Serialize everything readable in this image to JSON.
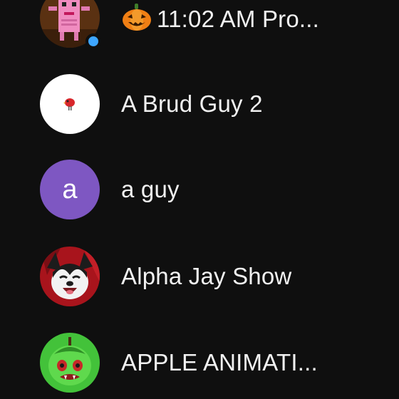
{
  "subscriptions": [
    {
      "name": "11:02 AM Pro...",
      "emoji": "pumpkin-icon",
      "has_new_content": true,
      "avatar": "pink-robot-avatar"
    },
    {
      "name": "A Brud Guy 2",
      "avatar": "red-bird-avatar"
    },
    {
      "name": "a guy",
      "avatar_letter": "a",
      "avatar_color": "#7e57c2"
    },
    {
      "name": "Alpha Jay Show",
      "avatar": "cartoon-dog-avatar"
    },
    {
      "name": "APPLE ANIMATI...",
      "avatar": "green-apple-avatar"
    }
  ],
  "colors": {
    "background": "#0f0f0f",
    "text": "#f1f1f1",
    "new_content_dot": "#3ea6ff"
  }
}
